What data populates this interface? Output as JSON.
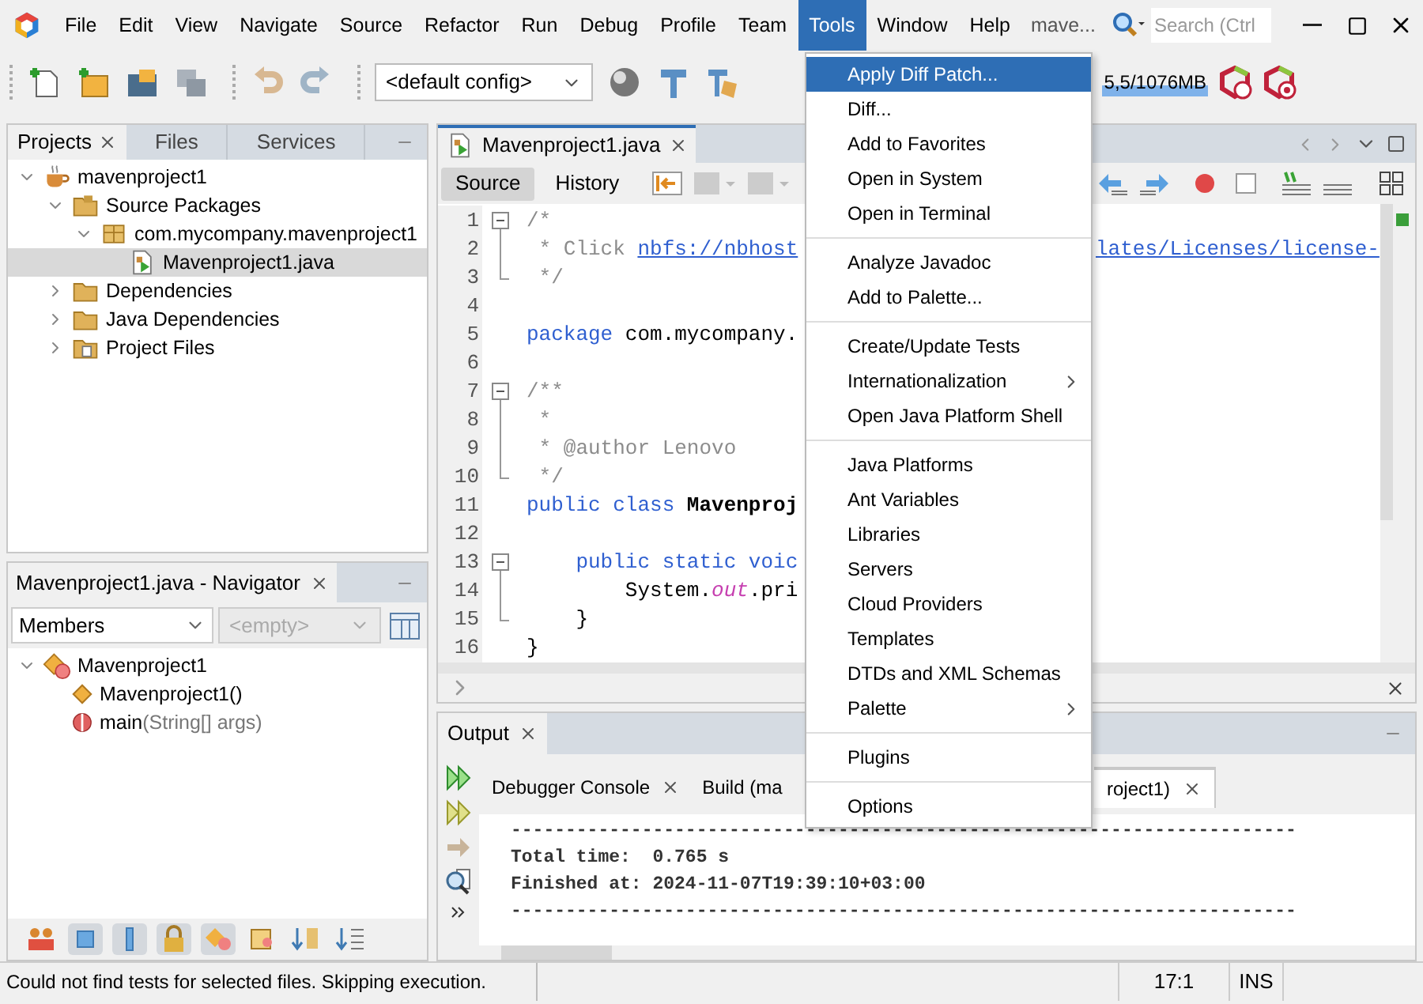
{
  "menu_bar": {
    "items": [
      {
        "label": "File",
        "selected": false
      },
      {
        "label": "Edit",
        "selected": false
      },
      {
        "label": "View",
        "selected": false
      },
      {
        "label": "Navigate",
        "selected": false
      },
      {
        "label": "Source",
        "selected": false
      },
      {
        "label": "Refactor",
        "selected": false
      },
      {
        "label": "Run",
        "selected": false
      },
      {
        "label": "Debug",
        "selected": false
      },
      {
        "label": "Profile",
        "selected": false
      },
      {
        "label": "Team",
        "selected": false
      },
      {
        "label": "Tools",
        "selected": true
      },
      {
        "label": "Window",
        "selected": false
      },
      {
        "label": "Help",
        "selected": false
      }
    ],
    "project_label": "mave...",
    "search": {
      "placeholder": "Search (Ctrl"
    }
  },
  "toolbar": {
    "config": "<default config>",
    "memory": "5,5/1076MB"
  },
  "projects_panel": {
    "tabs": [
      {
        "label": "Projects",
        "selected": true
      },
      {
        "label": "Files",
        "selected": false
      },
      {
        "label": "Services",
        "selected": false
      }
    ],
    "tree": [
      {
        "label": "mavenproject1",
        "kind": "project",
        "expanded": true,
        "selected": false,
        "children": [
          {
            "label": "Source Packages",
            "kind": "source-folder",
            "expanded": true,
            "selected": false,
            "children": [
              {
                "label": "com.mycompany.mavenproject1",
                "kind": "package",
                "expanded": true,
                "selected": false,
                "children": [
                  {
                    "label": "Mavenproject1.java",
                    "kind": "java-file",
                    "selected": true
                  }
                ]
              }
            ]
          },
          {
            "label": "Dependencies",
            "kind": "folder",
            "expanded": false,
            "selected": false
          },
          {
            "label": "Java Dependencies",
            "kind": "folder",
            "expanded": false,
            "selected": false
          },
          {
            "label": "Project Files",
            "kind": "files-folder",
            "expanded": false,
            "selected": false
          }
        ]
      }
    ]
  },
  "editor": {
    "tab": "Mavenproject1.java",
    "view_tabs": [
      {
        "label": "Source",
        "selected": true
      },
      {
        "label": "History",
        "selected": false
      }
    ],
    "lines": [
      {
        "number": "1",
        "fold_start": true,
        "code": [
          {
            "kind": "comment",
            "text": "/*"
          }
        ]
      },
      {
        "number": "2",
        "fold_body": true,
        "code": [
          {
            "kind": "comment",
            "text": " * Click "
          },
          {
            "kind": "link",
            "text": "nbfs://nbhost"
          }
        ],
        "code_right": [
          {
            "kind": "link",
            "text": "lates/Licenses/license-"
          }
        ]
      },
      {
        "number": "3",
        "fold_end": true,
        "code": [
          {
            "kind": "comment",
            "text": " */"
          }
        ]
      },
      {
        "number": "4"
      },
      {
        "number": "5",
        "code": [
          {
            "kind": "keyword",
            "text": "package"
          },
          {
            "kind": "plain",
            "text": " com.mycompany."
          }
        ]
      },
      {
        "number": "6"
      },
      {
        "number": "7",
        "fold_start": true,
        "code": [
          {
            "kind": "comment",
            "text": "/**"
          }
        ]
      },
      {
        "number": "8",
        "fold_body": true,
        "code": [
          {
            "kind": "comment",
            "text": " *"
          }
        ]
      },
      {
        "number": "9",
        "fold_body": true,
        "code": [
          {
            "kind": "comment",
            "text": " * @author Lenovo"
          }
        ]
      },
      {
        "number": "10",
        "fold_end": true,
        "code": [
          {
            "kind": "comment",
            "text": " */"
          }
        ]
      },
      {
        "number": "11",
        "code": [
          {
            "kind": "keyword",
            "text": "public class "
          },
          {
            "kind": "bold",
            "text": "Mavenproj"
          }
        ]
      },
      {
        "number": "12"
      },
      {
        "number": "13",
        "fold_start": true,
        "code": [
          {
            "kind": "keyword",
            "text": "    public static voic"
          }
        ]
      },
      {
        "number": "14",
        "fold_body": true,
        "code": [
          {
            "kind": "plain",
            "text": "        System."
          },
          {
            "kind": "field",
            "text": "out"
          },
          {
            "kind": "plain",
            "text": ".pri"
          }
        ]
      },
      {
        "number": "15",
        "fold_end": true,
        "code": [
          {
            "kind": "plain",
            "text": "    }"
          }
        ]
      },
      {
        "number": "16",
        "code": [
          {
            "kind": "plain",
            "text": "}"
          }
        ]
      }
    ]
  },
  "navigator": {
    "title": "Mavenproject1.java - Navigator",
    "filter": "Members",
    "secondary": {
      "value": "<empty>",
      "disabled": true
    },
    "tree": [
      {
        "label": "Mavenproject1",
        "kind": "class",
        "expanded": true,
        "selected": false,
        "children": [
          {
            "label": "Mavenproject1()",
            "kind": "constructor",
            "selected": false
          },
          {
            "label": "main",
            "detail": "(String[] args)",
            "kind": "method",
            "selected": false
          }
        ]
      }
    ]
  },
  "output": {
    "title": "Output",
    "tabs": [
      {
        "label": "Debugger Console",
        "selected": false
      },
      {
        "label": "Build (ma",
        "selected": false
      },
      {
        "label": "roject1)",
        "selected": true
      }
    ],
    "lines": [
      "------------------------------------------------------------------------",
      "Total time:  0.765 s",
      "Finished at: 2024-11-07T19:39:10+03:00",
      "------------------------------------------------------------------------"
    ]
  },
  "tools_menu": {
    "items": [
      {
        "kind": "item",
        "label": "Apply Diff Patch...",
        "selected": true,
        "submenu": false
      },
      {
        "kind": "item",
        "label": "Diff...",
        "selected": false,
        "submenu": false
      },
      {
        "kind": "item",
        "label": "Add to Favorites",
        "selected": false,
        "submenu": false
      },
      {
        "kind": "item",
        "label": "Open in System",
        "selected": false,
        "submenu": false
      },
      {
        "kind": "item",
        "label": "Open in Terminal",
        "selected": false,
        "submenu": false
      },
      {
        "kind": "separator"
      },
      {
        "kind": "item",
        "label": "Analyze Javadoc",
        "selected": false,
        "submenu": false
      },
      {
        "kind": "item",
        "label": "Add to Palette...",
        "selected": false,
        "submenu": false
      },
      {
        "kind": "separator"
      },
      {
        "kind": "item",
        "label": "Create/Update Tests",
        "selected": false,
        "submenu": false
      },
      {
        "kind": "item",
        "label": "Internationalization",
        "selected": false,
        "submenu": true
      },
      {
        "kind": "item",
        "label": "Open Java Platform Shell",
        "selected": false,
        "submenu": false
      },
      {
        "kind": "separator"
      },
      {
        "kind": "item",
        "label": "Java Platforms",
        "selected": false,
        "submenu": false
      },
      {
        "kind": "item",
        "label": "Ant Variables",
        "selected": false,
        "submenu": false
      },
      {
        "kind": "item",
        "label": "Libraries",
        "selected": false,
        "submenu": false
      },
      {
        "kind": "item",
        "label": "Servers",
        "selected": false,
        "submenu": false
      },
      {
        "kind": "item",
        "label": "Cloud Providers",
        "selected": false,
        "submenu": false
      },
      {
        "kind": "item",
        "label": "Templates",
        "selected": false,
        "submenu": false
      },
      {
        "kind": "item",
        "label": "DTDs and XML Schemas",
        "selected": false,
        "submenu": false
      },
      {
        "kind": "item",
        "label": "Palette",
        "selected": false,
        "submenu": true
      },
      {
        "kind": "separator"
      },
      {
        "kind": "item",
        "label": "Plugins",
        "selected": false,
        "submenu": false
      },
      {
        "kind": "separator"
      },
      {
        "kind": "item",
        "label": "Options",
        "selected": false,
        "submenu": false
      }
    ]
  },
  "status_bar": {
    "message": "Could not find tests for selected files. Skipping execution.",
    "position": "17:1",
    "mode": "INS"
  }
}
